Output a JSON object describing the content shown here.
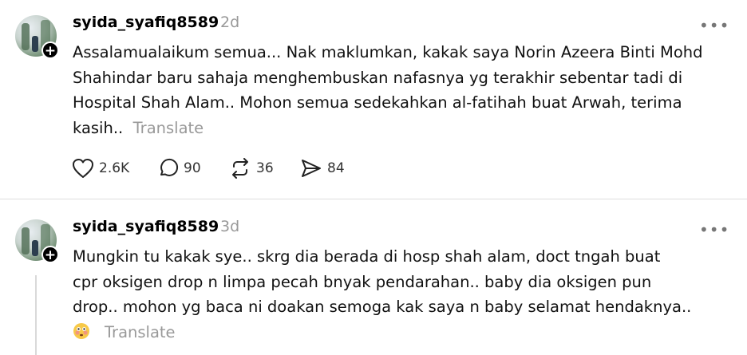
{
  "posts": [
    {
      "username": "syida_syafiq8589",
      "time": "2d",
      "lines": [
        "Assalamualaikum semua... Nak maklumkan, kakak saya Norin Azeera Binti Mohd",
        "Shahindar baru sahaja menghembuskan nafasnya yg terakhir sebentar tadi di",
        "Hospital Shah Alam.. Mohon semua sedekahkan al-fatihah buat Arwah, terima",
        "kasih.."
      ],
      "translate_label": "Translate",
      "actions": {
        "likes": "2.6K",
        "replies": "90",
        "reposts": "36",
        "shares": "84"
      }
    },
    {
      "username": "syida_syafiq8589",
      "time": "3d",
      "lines": [
        "Mungkin tu kakak sye.. skrg dia berada di hosp shah alam, doct tngah buat",
        "cpr oksigen drop n limpa pecah bnyak pendarahan.. baby dia oksigen pun",
        "drop.. mohon yg baca ni doakan semoga kak saya n baby selamat hendaknya.."
      ],
      "emoji": "flushed-face",
      "translate_label": "Translate"
    }
  ],
  "more_label": "•••"
}
